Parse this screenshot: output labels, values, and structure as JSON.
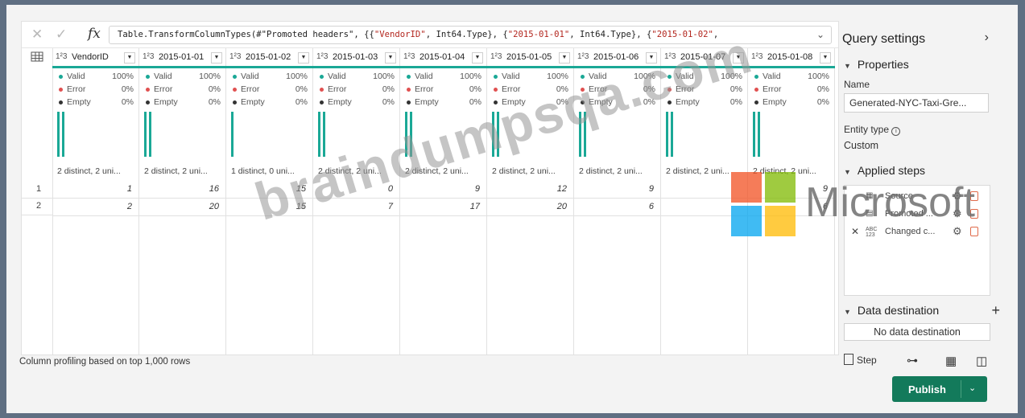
{
  "formula": {
    "fx": "fx",
    "prefix": "Table.TransformColumnTypes(#\"Promoted headers\", {{",
    "s1": "\"VendorID\"",
    "mid1": ", Int64.Type}, {",
    "s2": "\"2015-01-01\"",
    "mid2": ", Int64.Type}, {",
    "s3": "\"2015-01-02\"",
    "suffix": ","
  },
  "columns": [
    {
      "type": "1²3",
      "name": "VendorID",
      "valid_pct": "100%",
      "error_pct": "0%",
      "empty_pct": "0%",
      "distinct": "2 distinct, 2 uni...",
      "bars": 2,
      "rows": [
        "1",
        "2"
      ]
    },
    {
      "type": "1²3",
      "name": "2015-01-01",
      "valid_pct": "100%",
      "error_pct": "0%",
      "empty_pct": "0%",
      "distinct": "2 distinct, 2 uni...",
      "bars": 2,
      "rows": [
        "16",
        "20"
      ]
    },
    {
      "type": "1²3",
      "name": "2015-01-02",
      "valid_pct": "100%",
      "error_pct": "0%",
      "empty_pct": "0%",
      "distinct": "1 distinct, 0 uni...",
      "bars": 1,
      "rows": [
        "15",
        "15"
      ]
    },
    {
      "type": "1²3",
      "name": "2015-01-03",
      "valid_pct": "100%",
      "error_pct": "0%",
      "empty_pct": "0%",
      "distinct": "2 distinct, 2 uni...",
      "bars": 2,
      "rows": [
        "0",
        "7"
      ]
    },
    {
      "type": "1²3",
      "name": "2015-01-04",
      "valid_pct": "100%",
      "error_pct": "0%",
      "empty_pct": "0%",
      "distinct": "2 distinct, 2 uni...",
      "bars": 2,
      "rows": [
        "9",
        "17"
      ]
    },
    {
      "type": "1²3",
      "name": "2015-01-05",
      "valid_pct": "100%",
      "error_pct": "0%",
      "empty_pct": "0%",
      "distinct": "2 distinct, 2 uni...",
      "bars": 2,
      "rows": [
        "12",
        "20"
      ]
    },
    {
      "type": "1²3",
      "name": "2015-01-06",
      "valid_pct": "100%",
      "error_pct": "0%",
      "empty_pct": "0%",
      "distinct": "2 distinct, 2 uni...",
      "bars": 2,
      "rows": [
        "9",
        "6"
      ]
    },
    {
      "type": "1²3",
      "name": "2015-01-07",
      "valid_pct": "100%",
      "error_pct": "0%",
      "empty_pct": "0%",
      "distinct": "2 distinct, 2 uni...",
      "bars": 2,
      "rows": [
        "",
        ""
      ]
    },
    {
      "type": "1²3",
      "name": "2015-01-08",
      "valid_pct": "100%",
      "error_pct": "0%",
      "empty_pct": "0%",
      "distinct": "2 distinct, 2 uni...",
      "bars": 2,
      "rows": [
        "9",
        "6"
      ]
    }
  ],
  "profile_labels": {
    "valid": "Valid",
    "error": "Error",
    "empty": "Empty"
  },
  "row_numbers": [
    "1",
    "2"
  ],
  "status_text": "Column profiling based on top 1,000 rows",
  "query_settings": {
    "title": "Query settings",
    "properties_label": "Properties",
    "name_label": "Name",
    "name_value": "Generated-NYC-Taxi-Gre...",
    "entity_type_label": "Entity type",
    "entity_type_value": "Custom",
    "applied_steps_label": "Applied steps",
    "steps": [
      {
        "icon": "source-icon",
        "label": "Source"
      },
      {
        "icon": "table-icon",
        "label": "Promoted ..."
      },
      {
        "icon": "abc123-icon",
        "label": "Changed c..."
      }
    ],
    "data_destination_label": "Data destination",
    "no_destination": "No data destination"
  },
  "bottom": {
    "step_label": "Step",
    "publish_label": "Publish"
  },
  "watermark": {
    "text": "braindumpsqa.com",
    "logo_text": "Microsoft"
  },
  "colors": {
    "accent": "#1aa896",
    "publish": "#137a5b",
    "error": "#e05050"
  }
}
